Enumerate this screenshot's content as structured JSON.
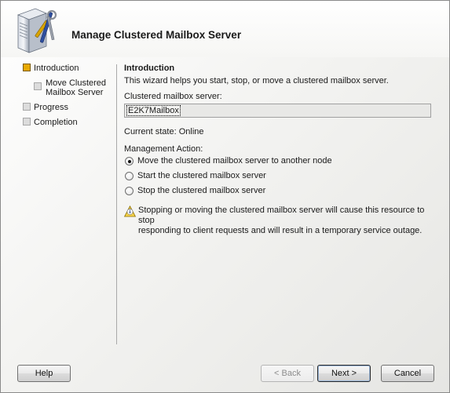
{
  "header": {
    "title": "Manage Clustered Mailbox Server",
    "icon": "server-tools-icon"
  },
  "nav": {
    "items": [
      {
        "label": "Introduction",
        "state": "active"
      },
      {
        "label": "Move Clustered Mailbox Server",
        "label_line1": "Move Clustered",
        "label_line2": "Mailbox Server",
        "state": "sub"
      },
      {
        "label": "Progress",
        "state": "inactive"
      },
      {
        "label": "Completion",
        "state": "inactive"
      }
    ]
  },
  "content": {
    "section_title": "Introduction",
    "description": "This wizard helps you start, stop, or move a clustered mailbox server.",
    "server_label": "Clustered mailbox server:",
    "server_value": "E2K7Mailbox",
    "current_state": "Current state: Online",
    "action_label": "Management Action:",
    "actions": [
      {
        "label": "Move the clustered mailbox server to another node",
        "checked": true
      },
      {
        "label": "Start the clustered mailbox server",
        "checked": false
      },
      {
        "label": "Stop the clustered mailbox server",
        "checked": false
      }
    ],
    "warning_line1": "Stopping or moving the clustered mailbox server will cause this resource to stop",
    "warning_line2": "responding to client requests and will result in a temporary service outage."
  },
  "buttons": {
    "help": "Help",
    "back": "< Back",
    "next": "Next >",
    "cancel": "Cancel"
  },
  "colors": {
    "active_step": "#e7a900",
    "inactive_step": "#dcdcdc",
    "separator": "#a9a9a9"
  }
}
